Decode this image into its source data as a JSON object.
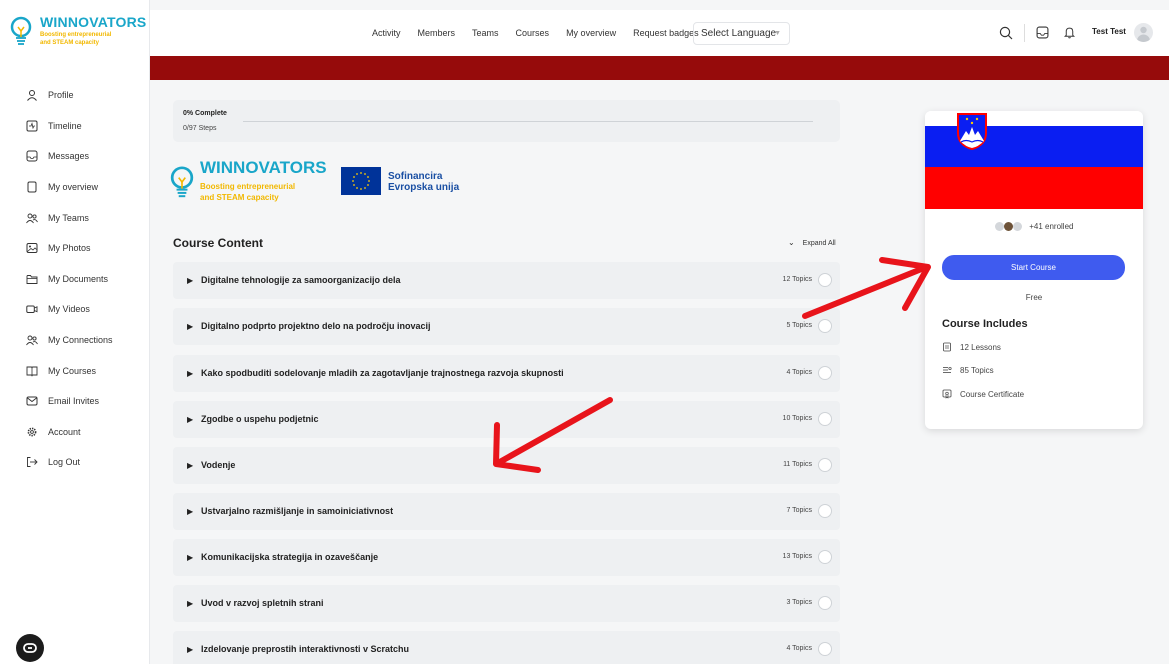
{
  "brand": {
    "name": "WINNOVATORS",
    "tagline1": "Boosting entrepreneurial",
    "tagline2": "and STEAM capacity"
  },
  "sidebar": {
    "items": [
      {
        "label": "Profile",
        "icon": "user-icon"
      },
      {
        "label": "Timeline",
        "icon": "timeline-icon"
      },
      {
        "label": "Messages",
        "icon": "inbox-icon"
      },
      {
        "label": "My overview",
        "icon": "document-icon"
      },
      {
        "label": "My Teams",
        "icon": "users-icon"
      },
      {
        "label": "My Photos",
        "icon": "image-icon"
      },
      {
        "label": "My Documents",
        "icon": "folder-icon"
      },
      {
        "label": "My Videos",
        "icon": "video-icon"
      },
      {
        "label": "My Connections",
        "icon": "users-icon"
      },
      {
        "label": "My Courses",
        "icon": "book-icon"
      },
      {
        "label": "Email Invites",
        "icon": "mail-icon"
      },
      {
        "label": "Account",
        "icon": "gear-icon"
      },
      {
        "label": "Log Out",
        "icon": "logout-icon"
      }
    ]
  },
  "topnav": {
    "items": [
      "Activity",
      "Members",
      "Teams",
      "Courses",
      "My overview",
      "Request badges"
    ],
    "language": "Select Language",
    "user": "Test Test"
  },
  "progress": {
    "percent_label": "0% Complete",
    "steps": "0/97 Steps",
    "percent": 0
  },
  "eu": {
    "line1": "Sofinancira",
    "line2": "Evropska unija"
  },
  "course": {
    "content_title": "Course Content",
    "expand_all": "Expand All",
    "lessons": [
      {
        "title": "Digitalne tehnologije za samoorganizacijo dela",
        "topics": "12 Topics"
      },
      {
        "title": "Digitalno podprto projektno delo na področju inovacij",
        "topics": "5 Topics"
      },
      {
        "title": "Kako spodbuditi sodelovanje mladih za zagotavljanje trajnostnega razvoja skupnosti",
        "topics": "4 Topics"
      },
      {
        "title": "Zgodbe o uspehu podjetnic",
        "topics": "10 Topics"
      },
      {
        "title": "Vodenje",
        "topics": "11 Topics"
      },
      {
        "title": "Ustvarjalno razmišljanje in samoiniciativnost",
        "topics": "7 Topics"
      },
      {
        "title": "Komunikacijska strategija in ozaveščanje",
        "topics": "13 Topics"
      },
      {
        "title": "Uvod v razvoj spletnih strani",
        "topics": "3 Topics"
      },
      {
        "title": "Izdelovanje preprostih interaktivnosti v Scratchu",
        "topics": "4 Topics"
      }
    ]
  },
  "card": {
    "enrolled": "+41 enrolled",
    "start_label": "Start Course",
    "price": "Free",
    "includes_title": "Course Includes",
    "includes": [
      "12 Lessons",
      "85 Topics",
      "Course Certificate"
    ]
  },
  "colors": {
    "accent": "#3f5bef",
    "banner": "#960b0b",
    "brand": "#19a6c9",
    "tagline": "#f2b800",
    "arrow": "#e8141b"
  }
}
